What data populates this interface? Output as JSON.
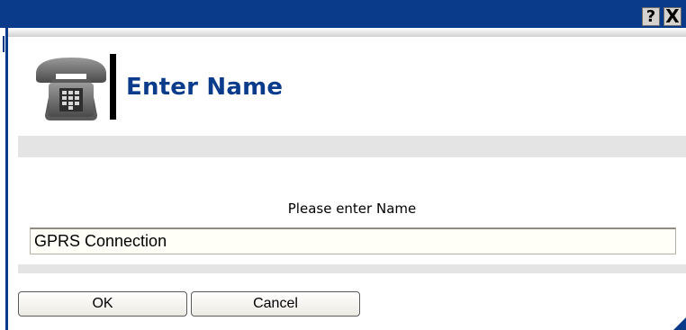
{
  "titlebar": {
    "help_label": "?",
    "close_label": "X"
  },
  "header": {
    "title": "Enter Name",
    "icon": "phone-icon"
  },
  "form": {
    "prompt": "Please enter Name",
    "name_value": "GPRS Connection"
  },
  "buttons": {
    "ok_label": "OK",
    "cancel_label": "Cancel"
  },
  "colors": {
    "titlebar": "#0a3a8a",
    "header_title": "#0b3c8c",
    "band": "#e4e4e4"
  }
}
